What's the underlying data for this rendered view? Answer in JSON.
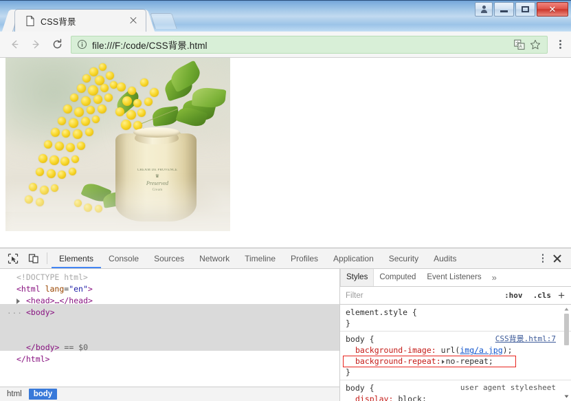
{
  "window": {
    "controls": {
      "user_label": "user-account",
      "minimize_label": "Minimize",
      "maximize_label": "Maximize",
      "close_label": "✕"
    }
  },
  "browser": {
    "tab": {
      "title": "CSS背景",
      "favicon": "page-icon",
      "close_label": "×"
    },
    "new_tab_label": "+",
    "nav": {
      "back_label": "Back",
      "forward_label": "Forward",
      "reload_label": "Reload"
    },
    "omnibox": {
      "url": "file:///F:/code/CSS背景.html",
      "info_icon": "info-icon",
      "translate_icon": "translate-icon",
      "bookmark_icon": "star-icon"
    },
    "menu_label": "Customize and control Google Chrome"
  },
  "page": {
    "jar_label_line1": "CREAM DE PROVENCE",
    "jar_label_crown": "♛",
    "jar_label_big": "Preserved",
    "jar_label_line3": "Cream"
  },
  "devtools": {
    "tools": {
      "inspect_icon": "inspect-cursor-icon",
      "device_icon": "device-toolbar-icon",
      "more_label": "More tools",
      "close_label": "Close DevTools"
    },
    "tabs": [
      {
        "label": "Elements",
        "active": true
      },
      {
        "label": "Console",
        "active": false
      },
      {
        "label": "Sources",
        "active": false
      },
      {
        "label": "Network",
        "active": false
      },
      {
        "label": "Timeline",
        "active": false
      },
      {
        "label": "Profiles",
        "active": false
      },
      {
        "label": "Application",
        "active": false
      },
      {
        "label": "Security",
        "active": false
      },
      {
        "label": "Audits",
        "active": false
      }
    ],
    "dom": {
      "lines": [
        {
          "text": "<!DOCTYPE html>"
        },
        {
          "text": "<html lang=\"en\">"
        },
        {
          "text": "<head>…</head>"
        },
        {
          "text": "<body>"
        },
        {
          "text": "</body>  == $0"
        },
        {
          "text": "</html>"
        }
      ],
      "doctype": "<!DOCTYPE html>",
      "html_open_tag": "<html",
      "html_attr_name": "lang",
      "html_attr_value": "\"en\"",
      "html_open_close": ">",
      "head_collapsed": "<head>…</head>",
      "body_open": "<body>",
      "body_close": "</body>",
      "selected_marker": "== $0",
      "html_close": "</html>"
    },
    "breadcrumbs": [
      {
        "label": "html",
        "active": false
      },
      {
        "label": "body",
        "active": true
      }
    ],
    "styles": {
      "tabs": [
        {
          "label": "Styles",
          "active": true
        },
        {
          "label": "Computed",
          "active": false
        },
        {
          "label": "Event Listeners",
          "active": false
        }
      ],
      "more_label": "»",
      "filter_placeholder": "Filter",
      "hov_label": ":hov",
      "cls_label": ".cls",
      "plus_label": "+",
      "rules": [
        {
          "selector": "element.style {",
          "source": "",
          "close": "}",
          "declarations": []
        },
        {
          "selector": "body {",
          "source": "CSS背景.html:7",
          "close": "}",
          "declarations": [
            {
              "property": "background-image:",
              "value": "url(",
              "link": "img/a.jpg",
              "value_tail": ");",
              "highlighted": false
            },
            {
              "property": "background-repeat:",
              "value": "no-repeat;",
              "highlighted": true
            }
          ]
        },
        {
          "selector": "body {",
          "source": "user agent stylesheet",
          "close": "",
          "declarations": [
            {
              "property": "display:",
              "value": "block;",
              "highlighted": false
            }
          ]
        }
      ]
    }
  },
  "colors": {
    "accent_blue": "#4285f4",
    "omnibox_green": "#d8efd7",
    "highlight_red": "#e8241d",
    "selection_blue": "#3879d9",
    "close_red": "#cc372c"
  }
}
